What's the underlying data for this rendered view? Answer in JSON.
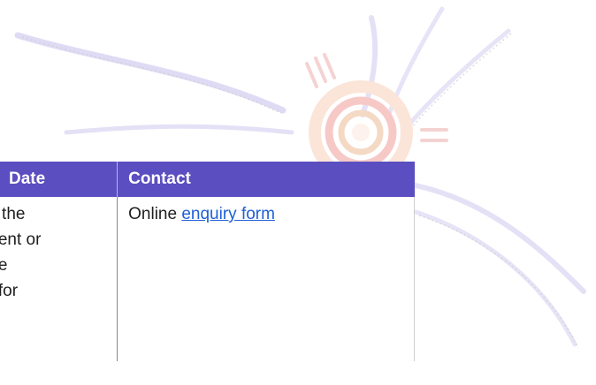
{
  "table": {
    "headers": {
      "date": "Date",
      "contact": "Contact"
    },
    "row": {
      "date_text": "ct the\nment or\nthe\ne for\n.",
      "contact_prefix": "Online ",
      "contact_link": "enquiry form"
    }
  },
  "colors": {
    "header_bg": "#5a4ec0",
    "link": "#1f5fd6"
  }
}
